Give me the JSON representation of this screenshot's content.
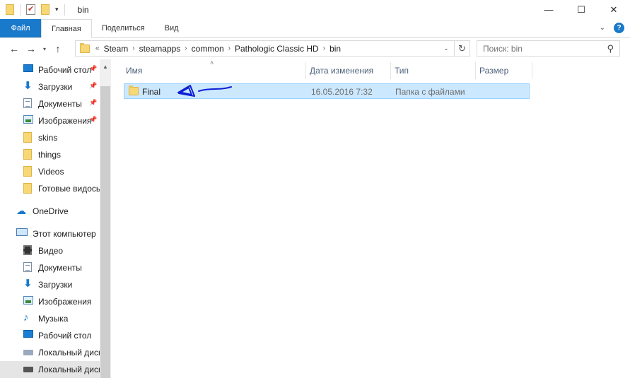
{
  "window": {
    "title": "bin",
    "minimize_glyph": "—",
    "maximize_glyph": "☐",
    "close_glyph": "✕"
  },
  "ribbon": {
    "tabs": [
      "Файл",
      "Главная",
      "Поделиться",
      "Вид"
    ],
    "collapse_glyph": "⌄",
    "help_glyph": "?"
  },
  "nav": {
    "back_glyph": "←",
    "forward_glyph": "→",
    "recent_glyph": "▾",
    "up_glyph": "↑"
  },
  "address": {
    "overflow": "«",
    "separator": "›",
    "crumbs": [
      "Steam",
      "steamapps",
      "common",
      "Pathologic Classic HD",
      "bin"
    ],
    "dropdown_glyph": "⌄",
    "refresh_glyph": "↻"
  },
  "search": {
    "placeholder": "Поиск: bin",
    "icon_glyph": "⚲"
  },
  "sidebar": {
    "pin_glyph": "📌",
    "scroll_up_glyph": "▲",
    "quick_access": [
      {
        "label": "Рабочий стол",
        "icon": "desktop-icon",
        "pinned": true
      },
      {
        "label": "Загрузки",
        "icon": "downloads-icon",
        "pinned": true
      },
      {
        "label": "Документы",
        "icon": "documents-icon",
        "pinned": true
      },
      {
        "label": "Изображения",
        "icon": "pictures-icon",
        "pinned": true
      },
      {
        "label": "skins",
        "icon": "folder-icon",
        "pinned": false
      },
      {
        "label": "things",
        "icon": "folder-icon",
        "pinned": false
      },
      {
        "label": "Videos",
        "icon": "folder-icon",
        "pinned": false
      },
      {
        "label": "Готовые видосы",
        "icon": "folder-icon",
        "pinned": false
      }
    ],
    "onedrive": {
      "label": "OneDrive",
      "icon": "onedrive-icon"
    },
    "this_pc": {
      "label": "Этот компьютер",
      "icon": "this-pc-icon"
    },
    "pc_items": [
      {
        "label": "Видео",
        "icon": "video-icon"
      },
      {
        "label": "Документы",
        "icon": "documents-icon"
      },
      {
        "label": "Загрузки",
        "icon": "downloads-icon"
      },
      {
        "label": "Изображения",
        "icon": "pictures-icon"
      },
      {
        "label": "Музыка",
        "icon": "music-icon"
      },
      {
        "label": "Рабочий стол",
        "icon": "desktop-icon"
      },
      {
        "label": "Локальный диск",
        "icon": "drive-icon"
      },
      {
        "label": "Локальный диск",
        "icon": "drive-icon",
        "selected": true
      }
    ]
  },
  "list": {
    "sort_glyph": "˄",
    "columns": [
      "Имя",
      "Дата изменения",
      "Тип",
      "Размер"
    ],
    "rows": [
      {
        "name": "Final",
        "date": "16.05.2016 7:32",
        "type": "Папка с файлами",
        "size": "",
        "selected": true
      }
    ]
  },
  "annotation": {
    "color": "#0d1fd6",
    "shape": "hand-drawn arrow"
  }
}
